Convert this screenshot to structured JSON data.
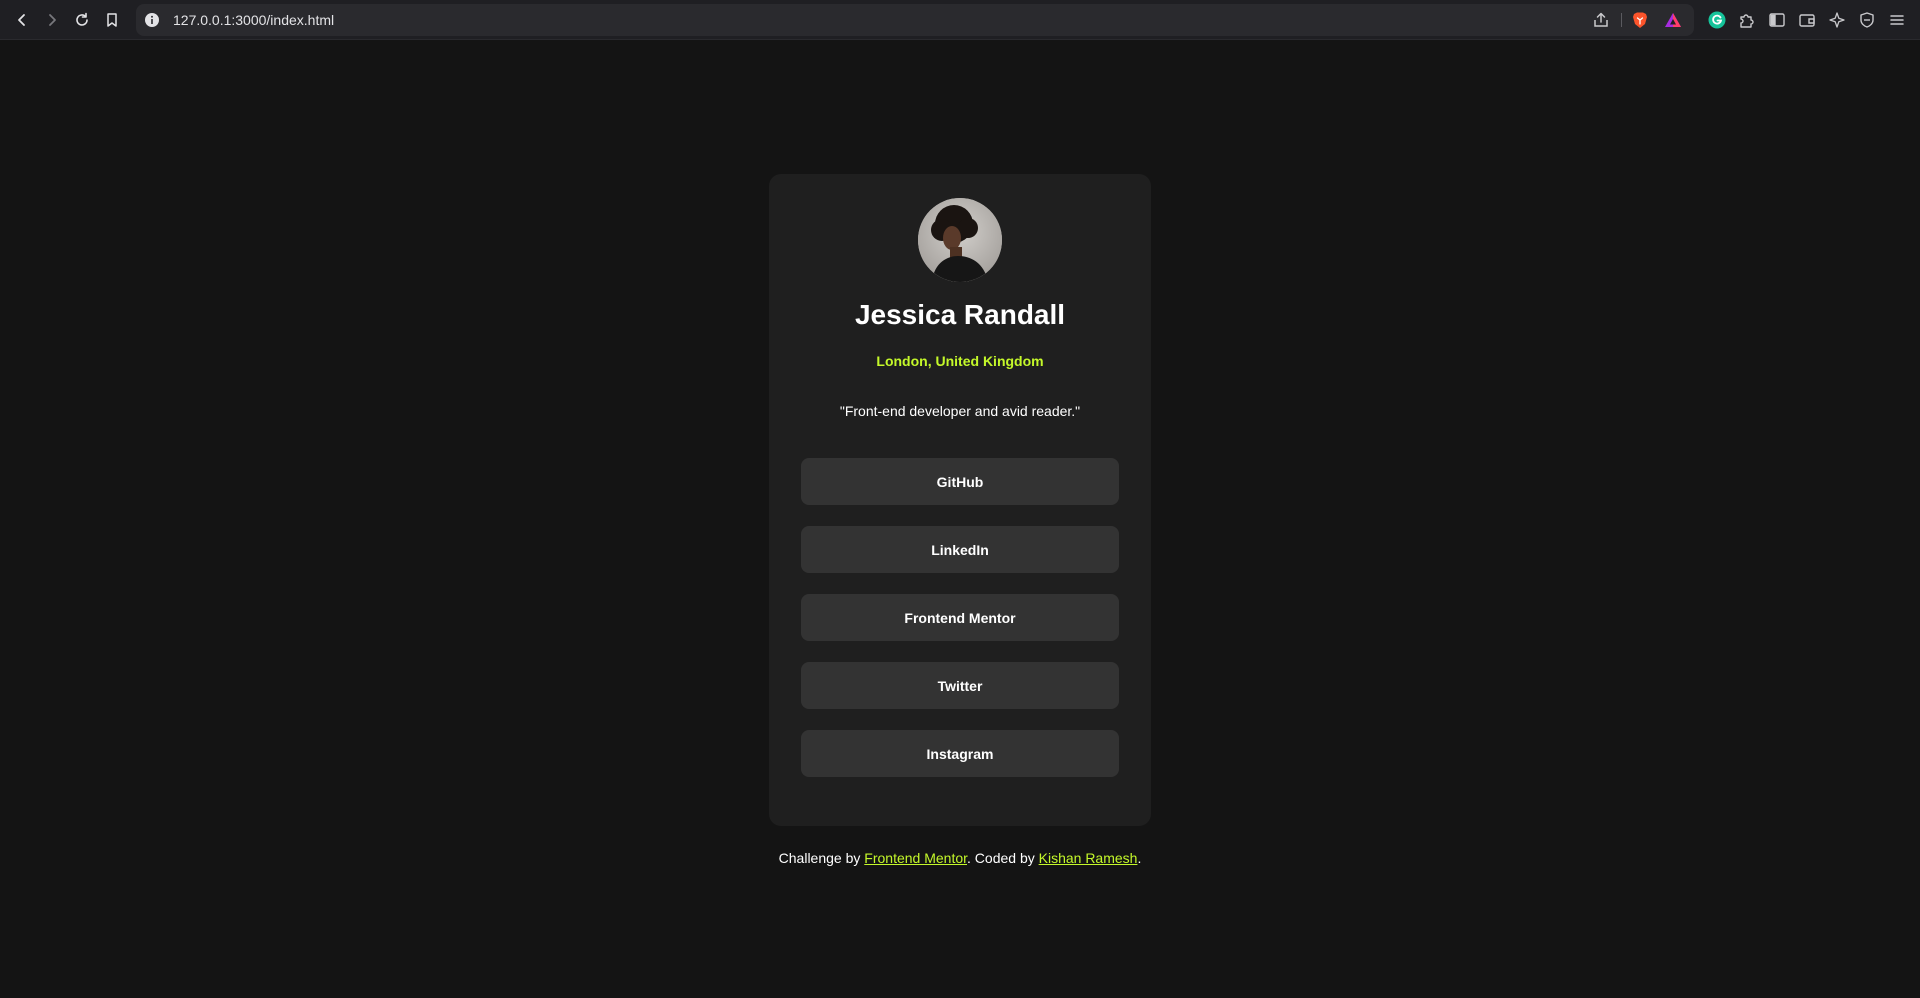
{
  "browser": {
    "url": "127.0.0.1:3000/index.html",
    "icons": {
      "back": "back-arrow-icon",
      "forward": "forward-arrow-icon",
      "reload": "reload-icon",
      "bookmark": "bookmark-icon",
      "site_info": "info-icon",
      "share": "share-icon",
      "brave_shields": "brave-lion-icon",
      "brave_rewards": "brave-rewards-triangle-icon",
      "grammarly": "grammarly-icon",
      "extensions": "puzzle-icon",
      "sidebar": "sidebar-icon",
      "wallet": "wallet-icon",
      "leo": "leo-ai-icon",
      "vpn": "vpn-shield-icon",
      "menu": "hamburger-menu-icon"
    }
  },
  "profile": {
    "name": "Jessica Randall",
    "location": "London, United Kingdom",
    "bio": "\"Front-end developer and avid reader.\""
  },
  "links": [
    {
      "label": "GitHub"
    },
    {
      "label": "LinkedIn"
    },
    {
      "label": "Frontend Mentor"
    },
    {
      "label": "Twitter"
    },
    {
      "label": "Instagram"
    }
  ],
  "attribution": {
    "prefix": "Challenge by ",
    "challenge_link": "Frontend Mentor",
    "middle": ". Coded by ",
    "author_link": "Kishan Ramesh",
    "suffix": "."
  },
  "colors": {
    "page_bg": "#141414",
    "card_bg": "#1f1f1f",
    "button_bg": "#333333",
    "accent": "#c4f82a",
    "text": "#ffffff"
  }
}
